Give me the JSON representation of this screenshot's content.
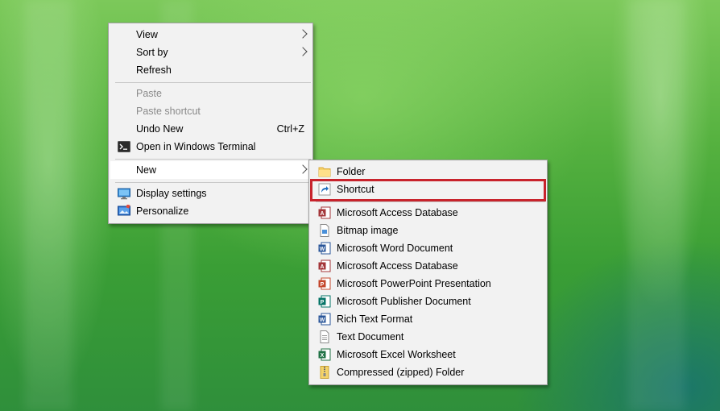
{
  "context_menu": {
    "items": [
      {
        "label": "View"
      },
      {
        "label": "Sort by"
      },
      {
        "label": "Refresh"
      },
      {
        "label": "Paste"
      },
      {
        "label": "Paste shortcut"
      },
      {
        "label": "Undo New",
        "shortcut": "Ctrl+Z"
      },
      {
        "label": "Open in Windows Terminal",
        "icon": "terminal-icon"
      },
      {
        "label": "New"
      },
      {
        "label": "Display settings",
        "icon": "display-icon"
      },
      {
        "label": "Personalize",
        "icon": "personalize-icon"
      }
    ]
  },
  "new_submenu": {
    "items": [
      {
        "label": "Folder",
        "icon": "folder-icon"
      },
      {
        "label": "Shortcut",
        "icon": "shortcut-icon"
      },
      {
        "label": "Microsoft Access Database",
        "icon": "access-icon"
      },
      {
        "label": "Bitmap image",
        "icon": "bitmap-icon"
      },
      {
        "label": "Microsoft Word Document",
        "icon": "word-icon"
      },
      {
        "label": "Microsoft Access Database",
        "icon": "access-icon"
      },
      {
        "label": "Microsoft PowerPoint Presentation",
        "icon": "powerpoint-icon"
      },
      {
        "label": "Microsoft Publisher Document",
        "icon": "publisher-icon"
      },
      {
        "label": "Rich Text Format",
        "icon": "rtf-icon"
      },
      {
        "label": "Text Document",
        "icon": "text-document-icon"
      },
      {
        "label": "Microsoft Excel Worksheet",
        "icon": "excel-icon"
      },
      {
        "label": "Compressed (zipped) Folder",
        "icon": "zip-folder-icon"
      }
    ]
  },
  "colors": {
    "highlight_border": "#c8232c",
    "menu_background": "#f2f2f2"
  }
}
